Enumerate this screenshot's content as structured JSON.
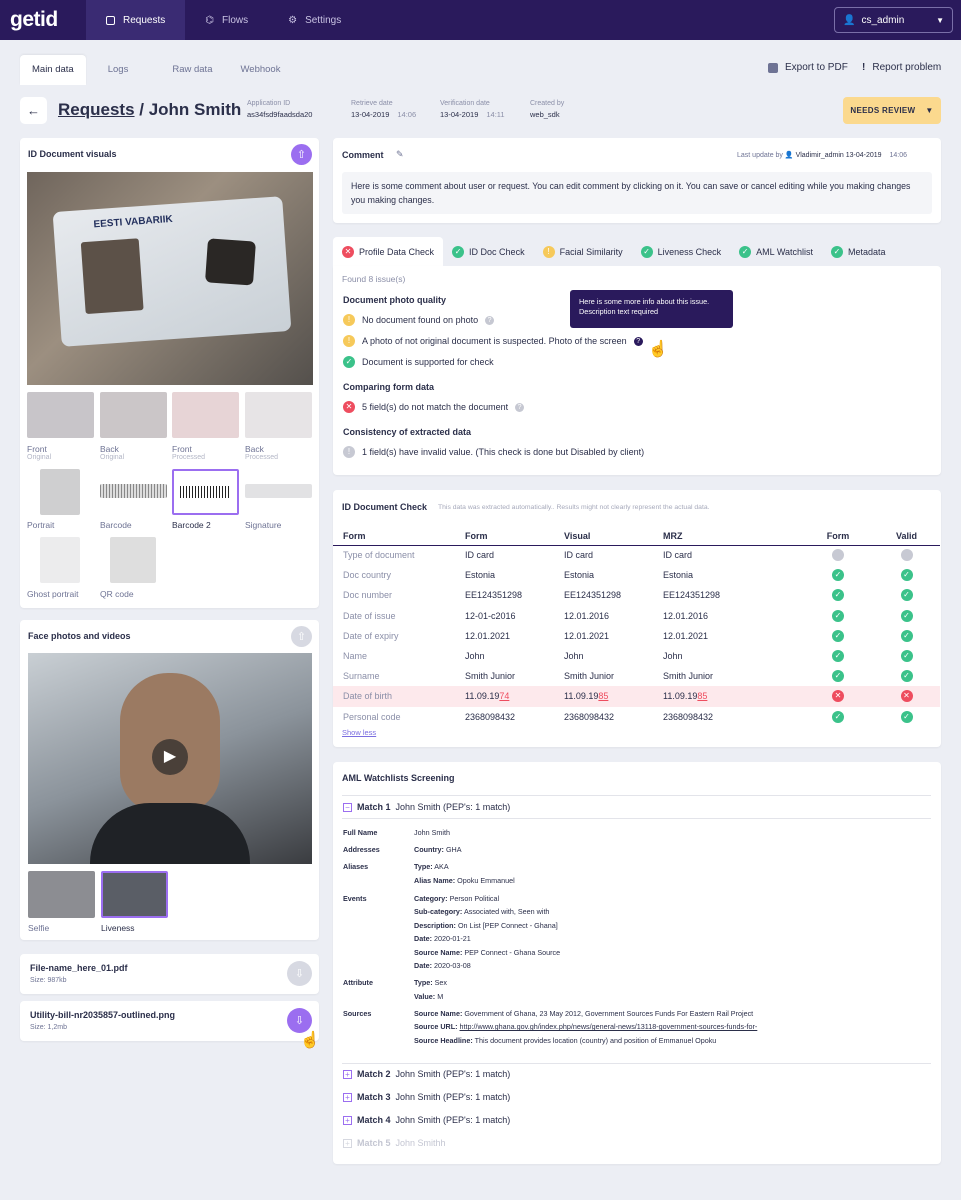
{
  "nav": {
    "logo": "getid",
    "items": [
      {
        "label": "Requests",
        "icon": "list-icon"
      },
      {
        "label": "Flows",
        "icon": "flow-icon"
      },
      {
        "label": "Settings",
        "icon": "gear-icon"
      }
    ],
    "user": "cs_admin"
  },
  "tabs": [
    "Main data",
    "Logs",
    "Raw data",
    "Webhook"
  ],
  "actions": {
    "export": "Export to PDF",
    "report": "Report problem"
  },
  "header": {
    "crumb": "Requests",
    "sep": " / ",
    "name": "John Smith",
    "meta": [
      {
        "label": "Application ID",
        "value": "as34fsd9faadsda20"
      },
      {
        "label": "Retrieve date",
        "value": "13-04-2019",
        "time": "14:06"
      },
      {
        "label": "Verification date",
        "value": "13-04-2019",
        "time": "14:11"
      },
      {
        "label": "Created by",
        "value": "web_sdk"
      }
    ],
    "status": "NEEDS REVIEW"
  },
  "idvisuals": {
    "title": "ID Document visuals",
    "card_title": "EESTI VABARIIK",
    "thumbs": [
      {
        "label": "Front",
        "sub": "Original"
      },
      {
        "label": "Back",
        "sub": "Original"
      },
      {
        "label": "Front",
        "sub": "Processed"
      },
      {
        "label": "Back",
        "sub": "Processed"
      },
      {
        "label": "Portrait"
      },
      {
        "label": "Barcode"
      },
      {
        "label": "Barcode 2"
      },
      {
        "label": "Signature"
      },
      {
        "label": "Ghost portrait"
      },
      {
        "label": "QR code"
      }
    ]
  },
  "face": {
    "title": "Face photos and videos",
    "thumbs": [
      {
        "label": "Selfie"
      },
      {
        "label": "Liveness"
      }
    ]
  },
  "files": [
    {
      "name": "File-name_here_01.pdf",
      "size": "Size: 987kb"
    },
    {
      "name": "Utility-bill-nr2035857-outlined.png",
      "size": "Size: 1,2mb"
    }
  ],
  "comment": {
    "label": "Comment",
    "updated": "Last update by",
    "user": "Vladimir_admin 13-04-2019",
    "time": "14:06",
    "text": "Here is some comment about user or request. You can edit comment by clicking on it. You can save or cancel editing while you making changes you making changes."
  },
  "checks_tabs": [
    {
      "label": "Profile Data Check",
      "status": "error"
    },
    {
      "label": "ID Doc Check",
      "status": "ok"
    },
    {
      "label": "Facial Similarity",
      "status": "warn"
    },
    {
      "label": "Liveness Check",
      "status": "ok"
    },
    {
      "label": "AML Watchlist",
      "status": "ok"
    },
    {
      "label": "Metadata",
      "status": "ok"
    }
  ],
  "profile": {
    "found": "Found 8 issue(s)",
    "sections": [
      {
        "title": "Document photo quality",
        "items": [
          {
            "text": "No document found on photo",
            "status": "warn"
          },
          {
            "text": "A photo of not original document is suspected. Photo of the screen",
            "status": "warn"
          },
          {
            "text": "Document is supported for check",
            "status": "ok"
          }
        ]
      },
      {
        "title": "Comparing form data",
        "items": [
          {
            "text": "5 field(s) do not match the document",
            "status": "error"
          }
        ]
      },
      {
        "title": "Consistency of extracted data",
        "items": [
          {
            "text": "1 field(s) have invalid value. (This check is done but Disabled by client)",
            "status": "grey"
          }
        ]
      }
    ],
    "tooltip": "Here is some more info about this issue. Description text required"
  },
  "idcheck": {
    "title": "ID Document Check",
    "note": "This data was extracted automatically.. Results might not clearly represent the actual data.",
    "headers": [
      "Form",
      "Form",
      "Visual",
      "MRZ",
      "Form",
      "Valid"
    ],
    "rows": [
      {
        "field": "Type of document",
        "form": "ID card",
        "visual": "ID card",
        "mrz": "ID card",
        "f": "grey",
        "v": "grey"
      },
      {
        "field": "Doc country",
        "form": "Estonia",
        "visual": "Estonia",
        "mrz": "Estonia",
        "f": "ok",
        "v": "ok"
      },
      {
        "field": "Doc number",
        "form": "EE124351298",
        "visual": "EE124351298",
        "mrz": "EE124351298",
        "f": "ok",
        "v": "ok"
      },
      {
        "field": "Date of issue",
        "form": "12-01-c2016",
        "visual": "12.01.2016",
        "mrz": "12.01.2016",
        "f": "ok",
        "v": "ok"
      },
      {
        "field": "Date of expiry",
        "form": "12.01.2021",
        "visual": "12.01.2021",
        "mrz": "12.01.2021",
        "f": "ok",
        "v": "ok"
      },
      {
        "field": "Name",
        "form": "John",
        "visual": "John",
        "mrz": "John",
        "f": "ok",
        "v": "ok"
      },
      {
        "field": "Surname",
        "form": "Smith Junior",
        "visual": "Smith Junior",
        "mrz": "Smith Junior",
        "f": "ok",
        "v": "ok"
      },
      {
        "field": "Date of birth",
        "form": "11.09.19",
        "form_bad": "74",
        "visual": "11.09.19",
        "visual_bad": "85",
        "mrz": "11.09.19",
        "mrz_bad": "85",
        "f": "error",
        "v": "error"
      },
      {
        "field": "Personal code",
        "form": "2368098432",
        "visual": "2368098432",
        "mrz": "2368098432",
        "f": "ok",
        "v": "ok"
      }
    ],
    "show_less": "Show less"
  },
  "aml": {
    "title": "AML Watchlists Screening",
    "match1": {
      "label": "Match 1",
      "desc": "John Smith (PEP's: 1 match)"
    },
    "details": [
      {
        "k": "Full Name",
        "lines": [
          {
            "v": "John Smith"
          }
        ]
      },
      {
        "k": "Addresses",
        "lines": [
          {
            "b": "Country:",
            "v": "GHA"
          }
        ]
      },
      {
        "k": "Aliases",
        "lines": [
          {
            "b": "Type:",
            "v": "AKA"
          },
          {
            "b": "Alias Name:",
            "v": "Opoku Emmanuel"
          }
        ]
      },
      {
        "k": "Events",
        "lines": [
          {
            "b": "Category:",
            "v": "Person Political"
          },
          {
            "b": "Sub-category:",
            "v": "Associated with, Seen with"
          },
          {
            "b": "Description:",
            "v": "On List [PEP Connect - Ghana]"
          },
          {
            "b": "Date:",
            "v": "2020-01-21"
          },
          {
            "b": "Source Name:",
            "v": "PEP Connect - Ghana Source"
          },
          {
            "b": "Date:",
            "v": "2020-03-08"
          }
        ]
      },
      {
        "k": "Attribute",
        "lines": [
          {
            "b": "Type:",
            "v": "Sex"
          },
          {
            "b": "Value:",
            "v": "M"
          }
        ]
      },
      {
        "k": "Sources",
        "lines": [
          {
            "b": "Source Name:",
            "v": "Government of Ghana, 23 May 2012, Government Sources Funds For Eastern Rail Project"
          },
          {
            "b": "Source URL:",
            "v": "http://www.ghana.gov.gh/index.php/news/general-news/13118-government-sources-funds-for-"
          },
          {
            "b": "Source Headline:",
            "v": "This document provides location (country) and position of Emmanuel Opoku"
          }
        ]
      }
    ],
    "others": [
      {
        "label": "Match 2",
        "desc": "John Smith (PEP's: 1 match)"
      },
      {
        "label": "Match 3",
        "desc": "John Smith (PEP's: 1 match)"
      },
      {
        "label": "Match 4",
        "desc": "John Smith (PEP's: 1 match)"
      },
      {
        "label": "Match 5",
        "desc": "John Smithh"
      }
    ]
  },
  "colors": {
    "nav": "#2a1a5c",
    "accent": "#9b6ef0",
    "ok": "#3bc28a",
    "error": "#ee4d5f",
    "warn": "#f6c95a",
    "review": "#fbd98e"
  }
}
